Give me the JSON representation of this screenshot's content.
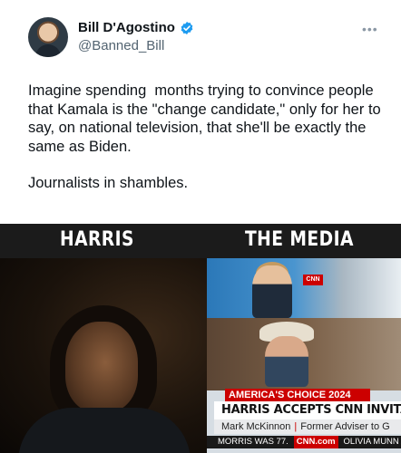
{
  "author": {
    "name": "Bill D'Agostino",
    "handle": "@Banned_Bill",
    "verified": true
  },
  "tweet": {
    "paragraph_1": "Imagine spending  months trying to convince people that Kamala is the \"change candidate,\" only for her to say, on national television, that she'll be exactly the same as Biden.",
    "paragraph_2": "Journalists in shambles."
  },
  "media": {
    "left_label": "HARRIS",
    "right_label": "THE MEDIA",
    "network_mini_logo": "CNN",
    "chyron_tag": "AMERICA'S CHOICE 2024",
    "chyron_headline": "HARRIS ACCEPTS CNN INVITATION FOR A S",
    "chyron_sub_name": "Mark McKinnon",
    "chyron_sub_title": "Former Adviser to G",
    "ticker_left": "MORRIS WAS 77.",
    "ticker_logo": "CNN.com",
    "ticker_right": "OLIVIA MUNN ANI"
  },
  "icons": {
    "verified": "verified-badge-icon",
    "more": "more-options-icon"
  },
  "colors": {
    "verified_blue": "#1d9bf0",
    "cnn_red": "#cc0000",
    "handle_gray": "#536471"
  }
}
